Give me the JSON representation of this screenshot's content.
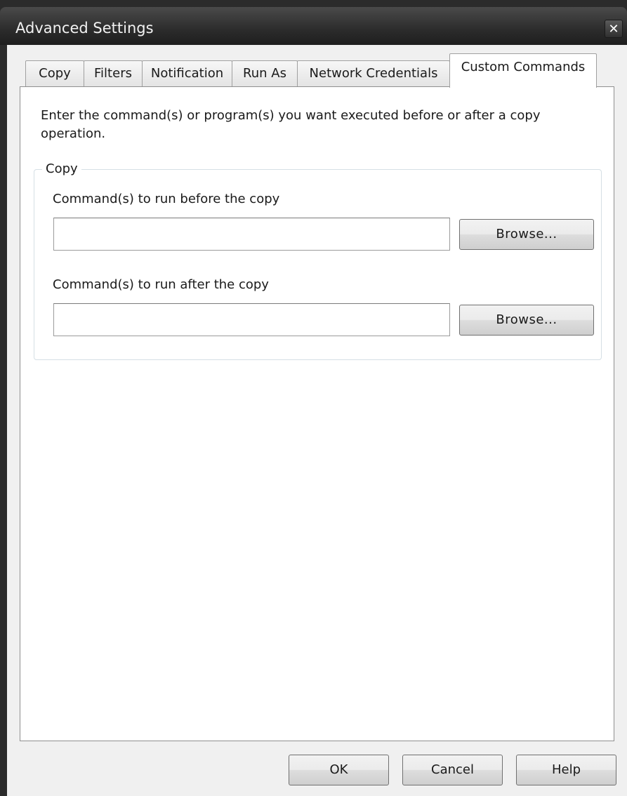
{
  "window": {
    "title": "Advanced Settings",
    "close_glyph": "✕"
  },
  "tabs": [
    {
      "label": "Copy",
      "active": false
    },
    {
      "label": "Filters",
      "active": false
    },
    {
      "label": "Notification",
      "active": false
    },
    {
      "label": "Run As",
      "active": false
    },
    {
      "label": "Network Credentials",
      "active": false
    },
    {
      "label": "Custom Commands",
      "active": true
    }
  ],
  "panel": {
    "description": "Enter the command(s) or program(s) you want executed before or after a copy operation.",
    "group": {
      "label": "Copy",
      "before": {
        "label": "Command(s) to run before the copy",
        "value": "",
        "browse_label": "Browse..."
      },
      "after": {
        "label": "Command(s) to run after the copy",
        "value": "",
        "browse_label": "Browse..."
      }
    }
  },
  "buttons": {
    "ok": "OK",
    "cancel": "Cancel",
    "help": "Help"
  },
  "colors": {
    "titlebar": "#2c2c2c",
    "client": "#f0f0f0",
    "panel": "#ffffff"
  },
  "icons": {
    "close": "close-icon"
  }
}
